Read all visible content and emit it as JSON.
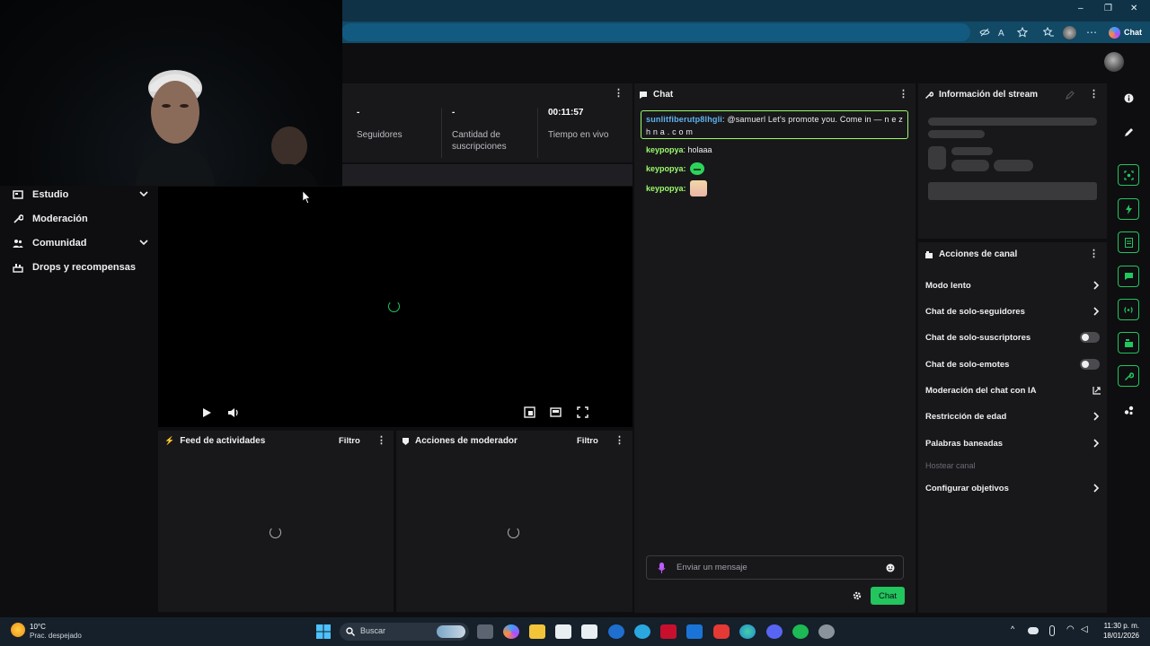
{
  "browser": {
    "chat_button_label": "Chat",
    "window_controls": [
      "–",
      "❐",
      "✕"
    ],
    "toolbar_icons": [
      "hide-icon",
      "read-aloud-icon",
      "favorite-star-icon",
      "favorites-icon",
      "profile-avatar-icon",
      "more-icon"
    ]
  },
  "sidebar": {
    "items": [
      {
        "label": "Estudio",
        "icon": "studio-icon",
        "expandable": true
      },
      {
        "label": "Moderación",
        "icon": "wrench-icon",
        "expandable": false
      },
      {
        "label": "Comunidad",
        "icon": "community-icon",
        "expandable": true
      },
      {
        "label": "Drops y recompensas",
        "icon": "drops-icon",
        "expandable": false
      }
    ]
  },
  "stats": [
    {
      "value": "-",
      "label": "Seguidores"
    },
    {
      "value": "-",
      "label": "Cantidad de suscripciones"
    },
    {
      "value": "00:11:57",
      "label": "Tiempo en vivo"
    }
  ],
  "feeds": {
    "activity": {
      "title": "Feed de actividades",
      "filter": "Filtro"
    },
    "moderator": {
      "title": "Acciones de moderador",
      "filter": "Filtro"
    }
  },
  "chat": {
    "title": "Chat",
    "messages": [
      {
        "user": "sunlitfiberutp8lhgli",
        "text": ": @samuerl Let's promote you. Come in — n e z h n a . c o m",
        "highlighted": true
      },
      {
        "user": "keypopya",
        "text": ": holaaa"
      },
      {
        "user": "keypopya",
        "text": ":",
        "emote": "green-frog-emote"
      },
      {
        "user": "keypopya",
        "text": ":",
        "emote": "anime-girl-emote"
      }
    ],
    "input_placeholder": "Enviar un mensaje",
    "send_label": "Chat"
  },
  "stream_info": {
    "title": "Información del stream"
  },
  "channel_actions": {
    "title": "Acciones de canal",
    "items": [
      {
        "label": "Modo lento",
        "control": "chevron"
      },
      {
        "label": "Chat de solo-seguidores",
        "control": "chevron"
      },
      {
        "label": "Chat de solo-suscriptores",
        "control": "toggle"
      },
      {
        "label": "Chat de solo-emotes",
        "control": "toggle"
      },
      {
        "label": "Moderación del chat con IA",
        "control": "external"
      },
      {
        "label": "Restricción de edad",
        "control": "chevron"
      },
      {
        "label": "Palabras baneadas",
        "control": "chevron"
      },
      {
        "label": "Hostear canal",
        "control": "none",
        "disabled": true
      },
      {
        "label": "Configurar objetivos",
        "control": "chevron"
      }
    ]
  },
  "taskbar": {
    "weather_temp": "10°C",
    "weather_desc": "Prac. despejado",
    "search_placeholder": "Buscar",
    "time": "11:30 p. m.",
    "date": "18/01/2026"
  },
  "colors": {
    "accent": "#22c55e",
    "username": "#9cfa6b",
    "bg": "#0e0e10",
    "panel": "#18181b"
  }
}
